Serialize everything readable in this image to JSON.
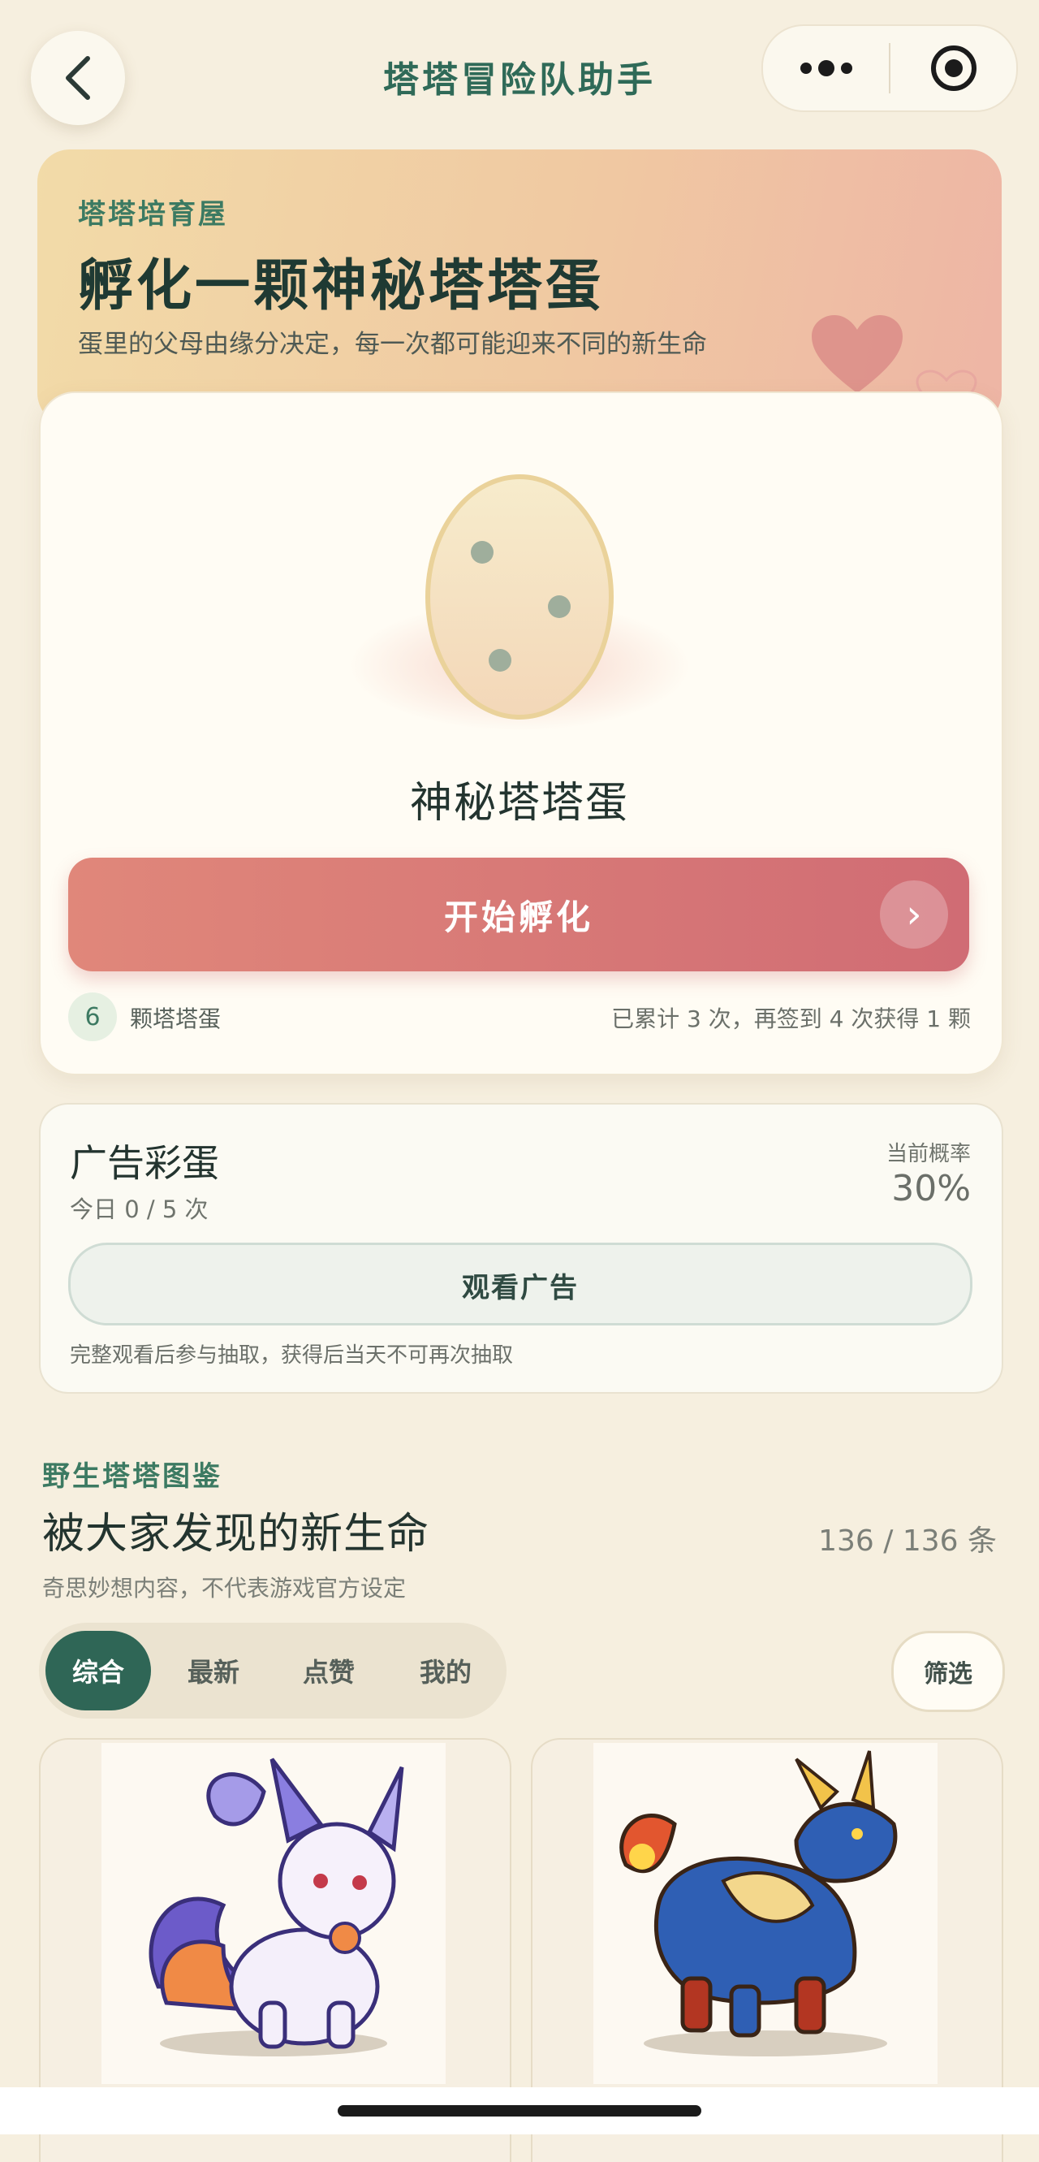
{
  "nav": {
    "title": "塔塔冒险队助手"
  },
  "hero": {
    "kicker": "塔塔培育屋",
    "title": "孵化一颗神秘塔塔蛋",
    "subtitle": "蛋里的父母由缘分决定，每一次都可能迎来不同的新生命"
  },
  "egg_card": {
    "egg_name": "神秘塔塔蛋",
    "hatch_label": "开始孵化",
    "egg_count": "6",
    "egg_unit": "颗塔塔蛋",
    "signin_note": "已累计 3 次，再签到 4 次获得 1 颗"
  },
  "ad_card": {
    "title": "广告彩蛋",
    "today": "今日 0 / 5 次",
    "prob_label": "当前概率",
    "prob_value": "30%",
    "button_label": "观看广告",
    "note": "完整观看后参与抽取，获得后当天不可再次抽取"
  },
  "gallery": {
    "kicker": "野生塔塔图鉴",
    "title": "被大家发现的新生命",
    "count": "136 / 136 条",
    "subtitle": "奇思妙想内容，不代表游戏官方设定",
    "tabs": [
      "综合",
      "最新",
      "点赞",
      "我的"
    ],
    "active_tab": 0,
    "filter_label": "筛选"
  },
  "colors": {
    "accent_green": "#2f6656",
    "hatch_red": "#d06c74",
    "background": "#f6efdf"
  },
  "icons": [
    "chevron-left-icon",
    "more-dots-icon",
    "target-icon",
    "heart-icon",
    "chevron-right-icon"
  ]
}
